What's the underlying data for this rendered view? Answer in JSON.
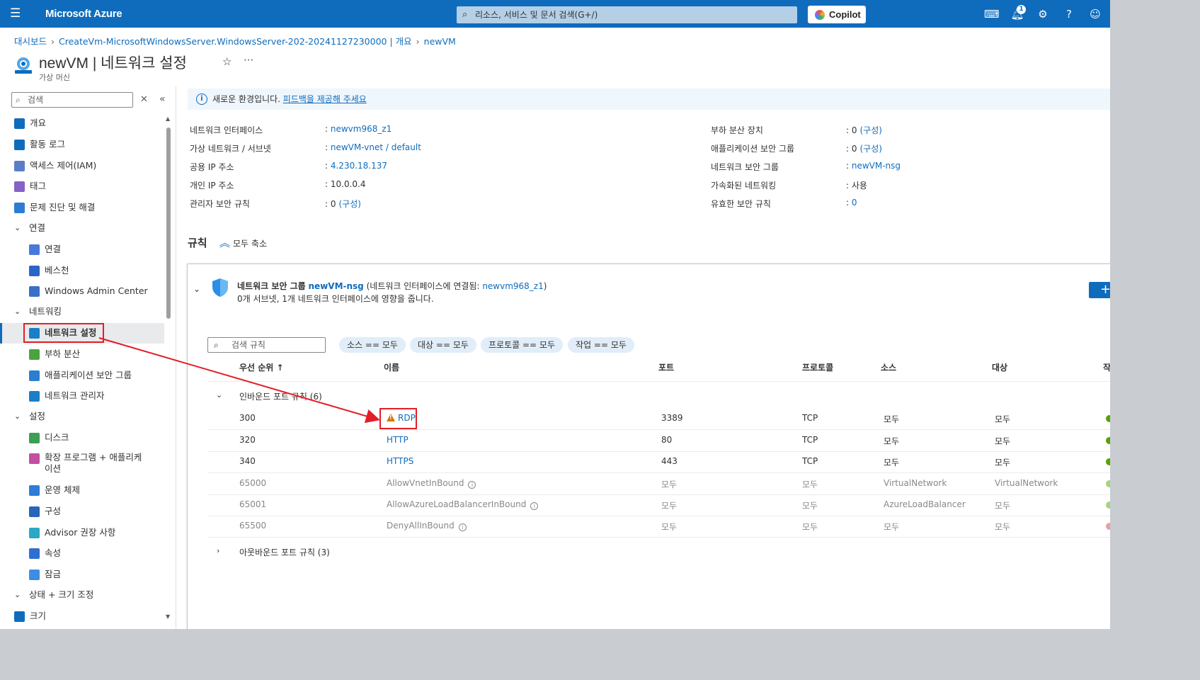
{
  "topbar": {
    "brand": "Microsoft Azure",
    "search_placeholder": "리소스, 서비스 및 문서 검색(G+/)",
    "copilot_label": "Copilot",
    "notification_count": "1"
  },
  "breadcrumb": [
    "대시보드",
    "CreateVm-MicrosoftWindowsServer.WindowsServer-202-20241127230000 | 개요",
    "newVM"
  ],
  "page": {
    "title": "newVM | 네트워크 설정",
    "subtitle": "가상 머신"
  },
  "sidebar": {
    "search_placeholder": "검색",
    "items": [
      {
        "label": "개요",
        "color": "#0f6cbd"
      },
      {
        "label": "활동 로그",
        "color": "#0f6cbd"
      },
      {
        "label": "액세스 제어(IAM)",
        "color": "#5c7ec7"
      },
      {
        "label": "태그",
        "color": "#8661c5"
      },
      {
        "label": "문제 진단 및 해결",
        "color": "#2e7cd6"
      },
      {
        "label": "연결",
        "group": true
      },
      {
        "label": "연결",
        "color": "#4a7ad9"
      },
      {
        "label": "베스천",
        "color": "#2b64c8"
      },
      {
        "label": "Windows Admin Center",
        "color": "#3b6fc6"
      },
      {
        "label": "네트워킹",
        "group": true
      },
      {
        "label": "네트워크 설정",
        "color": "#1a7fc9"
      },
      {
        "label": "부하 분산",
        "color": "#49a43e"
      },
      {
        "label": "애플리케이션 보안 그룹",
        "color": "#2b7ed0"
      },
      {
        "label": "네트워크 관리자",
        "color": "#1a7fc9"
      },
      {
        "label": "설정",
        "group": true
      },
      {
        "label": "디스크",
        "color": "#3c9f53"
      },
      {
        "label": "확장 프로그램 + 애플리케이션",
        "color": "#c24fa1"
      },
      {
        "label": "운영 체제",
        "color": "#2e7cd6"
      },
      {
        "label": "구성",
        "color": "#2766b9"
      },
      {
        "label": "Advisor 권장 사항",
        "color": "#2aa8c7"
      },
      {
        "label": "속성",
        "color": "#2f6fd2"
      },
      {
        "label": "잠금",
        "color": "#3d8ee3"
      },
      {
        "label": "상태 + 크기 조정",
        "group": true
      },
      {
        "label": "크기",
        "color": "#0f6cbd"
      }
    ]
  },
  "banner": {
    "text": "새로운 환경입니다.",
    "link": "피드백을 제공해 주세요"
  },
  "properties_left": [
    {
      "key": "네트워크 인터페이스",
      "value": "newvm968_z1",
      "link": true
    },
    {
      "key": "가상 네트워크 / 서브넷",
      "value": "newVM-vnet / default",
      "link": true
    },
    {
      "key": "공용 IP 주소",
      "value": "4.230.18.137",
      "link": true
    },
    {
      "key": "개인 IP 주소",
      "value": "10.0.0.4",
      "link": false
    },
    {
      "key": "관리자 보안 규칙",
      "value": "0",
      "extra": "(구성)"
    }
  ],
  "properties_right": [
    {
      "key": "부하 분산 장치",
      "value": "0",
      "extra": "(구성)"
    },
    {
      "key": "애플리케이션 보안 그룹",
      "value": "0",
      "extra": "(구성)"
    },
    {
      "key": "네트워크 보안 그룹",
      "value": "newVM-nsg",
      "link": true
    },
    {
      "key": "가속화된 네트워킹",
      "value": "사용",
      "link": false
    },
    {
      "key": "유효한 보안 규칙",
      "value": "0",
      "link": true
    }
  ],
  "rules": {
    "title": "규칙",
    "collapse_all": "모두 축소",
    "nsg": {
      "prefix": "네트워크 보안 그룹",
      "name": "newVM-nsg",
      "attached_prefix": "(네트워크 인터페이스에 연결됨:",
      "nic": "newvm968_z1",
      "suffix": ")",
      "desc": "0개 서브넷, 1개 네트워크 인터페이스에 영향을 줍니다."
    },
    "search_placeholder": "검색 규칙",
    "filters": [
      "소스 == 모두",
      "대상 == 모두",
      "프로토콜 == 모두",
      "작업 == 모두"
    ],
    "headers": [
      "우선 순위 ↑",
      "이름",
      "포트",
      "프로토콜",
      "소스",
      "대상",
      "작"
    ],
    "inbound_label": "인바운드 포트 규칙 (6)",
    "outbound_label": "아웃바운드 포트 규칙 (3)",
    "inbound": [
      {
        "priority": "300",
        "name": "RDP",
        "port": "3389",
        "protocol": "TCP",
        "source": "모두",
        "dest": "모두",
        "warn": true,
        "dim": false,
        "status": "#57a300"
      },
      {
        "priority": "320",
        "name": "HTTP",
        "port": "80",
        "protocol": "TCP",
        "source": "모두",
        "dest": "모두",
        "warn": false,
        "dim": false,
        "status": "#57a300"
      },
      {
        "priority": "340",
        "name": "HTTPS",
        "port": "443",
        "protocol": "TCP",
        "source": "모두",
        "dest": "모두",
        "warn": false,
        "dim": false,
        "status": "#57a300"
      },
      {
        "priority": "65000",
        "name": "AllowVnetInBound",
        "port": "모두",
        "protocol": "모두",
        "source": "VirtualNetwork",
        "dest": "VirtualNetwork",
        "warn": false,
        "dim": true,
        "status": "#a5d67a"
      },
      {
        "priority": "65001",
        "name": "AllowAzureLoadBalancerInBound",
        "port": "모두",
        "protocol": "모두",
        "source": "AzureLoadBalancer",
        "dest": "모두",
        "warn": false,
        "dim": true,
        "status": "#a5d67a"
      },
      {
        "priority": "65500",
        "name": "DenyAllInBound",
        "port": "모두",
        "protocol": "모두",
        "source": "모두",
        "dest": "모두",
        "warn": false,
        "dim": true,
        "status": "#e8a1a1"
      }
    ]
  },
  "colors": {
    "brand": "#0f6cbd",
    "highlight": "#e41e26"
  }
}
